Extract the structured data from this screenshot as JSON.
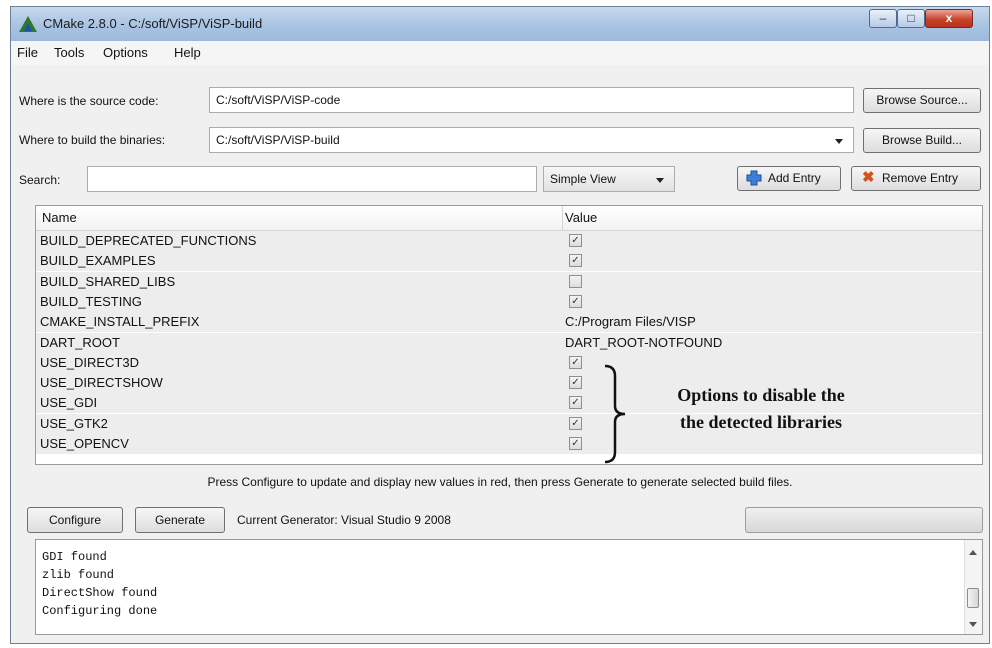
{
  "window": {
    "title": "CMake 2.8.0 - C:/soft/ViSP/ViSP-build",
    "minimize": "–",
    "maximize": "□",
    "close": "x"
  },
  "menu": [
    "File",
    "Tools",
    "Options",
    "Help"
  ],
  "source": {
    "label": "Where is the source code:",
    "value": "C:/soft/ViSP/ViSP-code",
    "button": "Browse Source..."
  },
  "build": {
    "label": "Where to build the binaries:",
    "value": "C:/soft/ViSP/ViSP-build",
    "button": "Browse Build..."
  },
  "search": {
    "label": "Search:",
    "value": "",
    "view": "Simple View",
    "add": "Add Entry",
    "remove": "Remove Entry"
  },
  "table": {
    "headers": {
      "name": "Name",
      "value": "Value"
    },
    "rows": [
      {
        "name": "BUILD_DEPRECATED_FUNCTIONS",
        "checked": true
      },
      {
        "name": "BUILD_EXAMPLES",
        "checked": true
      },
      {
        "name": "BUILD_SHARED_LIBS",
        "checked": false
      },
      {
        "name": "BUILD_TESTING",
        "checked": true
      },
      {
        "name": "CMAKE_INSTALL_PREFIX",
        "text": "C:/Program Files/VISP"
      },
      {
        "name": "DART_ROOT",
        "text": "DART_ROOT-NOTFOUND"
      },
      {
        "name": "USE_DIRECT3D",
        "checked": true
      },
      {
        "name": "USE_DIRECTSHOW",
        "checked": true
      },
      {
        "name": "USE_GDI",
        "checked": true
      },
      {
        "name": "USE_GTK2",
        "checked": true
      },
      {
        "name": "USE_OPENCV",
        "checked": true
      }
    ]
  },
  "annotation": {
    "line1": "Options to disable the",
    "line2": "the detected libraries"
  },
  "status_message": "Press Configure to update and display new values in red, then press Generate to generate selected build files.",
  "buttons": {
    "configure": "Configure",
    "generate": "Generate"
  },
  "generator": "Current Generator: Visual Studio 9 2008",
  "output": [
    "-------- -----",
    "GDI found",
    "zlib found",
    "DirectShow found",
    "Configuring done"
  ],
  "icons": {
    "app": "cmake-triangle-icon",
    "add": "plus-icon",
    "remove": "red-x-icon",
    "check": "checkmark-icon"
  }
}
